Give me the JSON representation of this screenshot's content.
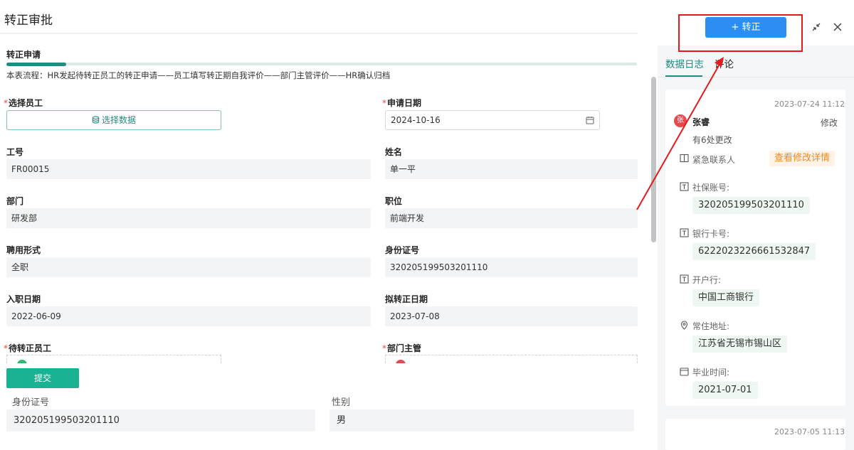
{
  "left": {
    "title": "转正审批",
    "section_title": "转正申请",
    "flow": "本表流程：HR发起待转正员工的转正申请——员工填写转正期自我评价——部门主管评价——HR确认归档",
    "select_employee_label": "选择员工",
    "select_data_button": "选择数据",
    "apply_date_label": "申请日期",
    "apply_date_value": "2024-10-16",
    "fields": [
      {
        "label": "工号",
        "value": "FR00015"
      },
      {
        "label": "姓名",
        "value": "单一平"
      },
      {
        "label": "部门",
        "value": "研发部"
      },
      {
        "label": "职位",
        "value": "前端开发"
      },
      {
        "label": "聘用形式",
        "value": "全职"
      },
      {
        "label": "身份证号",
        "value": "320205199503201110"
      },
      {
        "label": "入职日期",
        "value": "2022-06-09"
      },
      {
        "label": "拟转正日期",
        "value": "2023-07-08"
      }
    ],
    "pending_employee_label": "待转正员工",
    "dept_manager_label": "部门主管",
    "submit_label": "提交",
    "id_label": "身份证号",
    "id_value": "320205199503201110",
    "gender_label": "性别",
    "gender_value": "男"
  },
  "toolbar": {
    "add_label": "+ 转正"
  },
  "right": {
    "tabs": [
      "数据日志",
      "评论"
    ],
    "log1": {
      "time": "2023-07-24 11:12",
      "avatar_char": "张",
      "user": "张睿",
      "action": "修改",
      "changes": "有6处更改",
      "emergency_label": "紧急联系人",
      "detail_link": "查看修改详情",
      "items": [
        {
          "label": "社保账号:",
          "value": "320205199503201110"
        },
        {
          "label": "银行卡号:",
          "value": "6222023226661532847"
        },
        {
          "label": "开户行:",
          "value": "中国工商银行"
        },
        {
          "label": "常住地址:",
          "value": "江苏省无锡市锡山区"
        },
        {
          "label": "毕业时间:",
          "value": "2021-07-01"
        }
      ]
    },
    "log2": {
      "time": "2023-07-05 11:13"
    }
  },
  "colors": {
    "primary": "#1f8c7e",
    "accent_blue": "#2c8ef3",
    "highlight_red": "#e5191c",
    "submit_green": "#19b394"
  }
}
